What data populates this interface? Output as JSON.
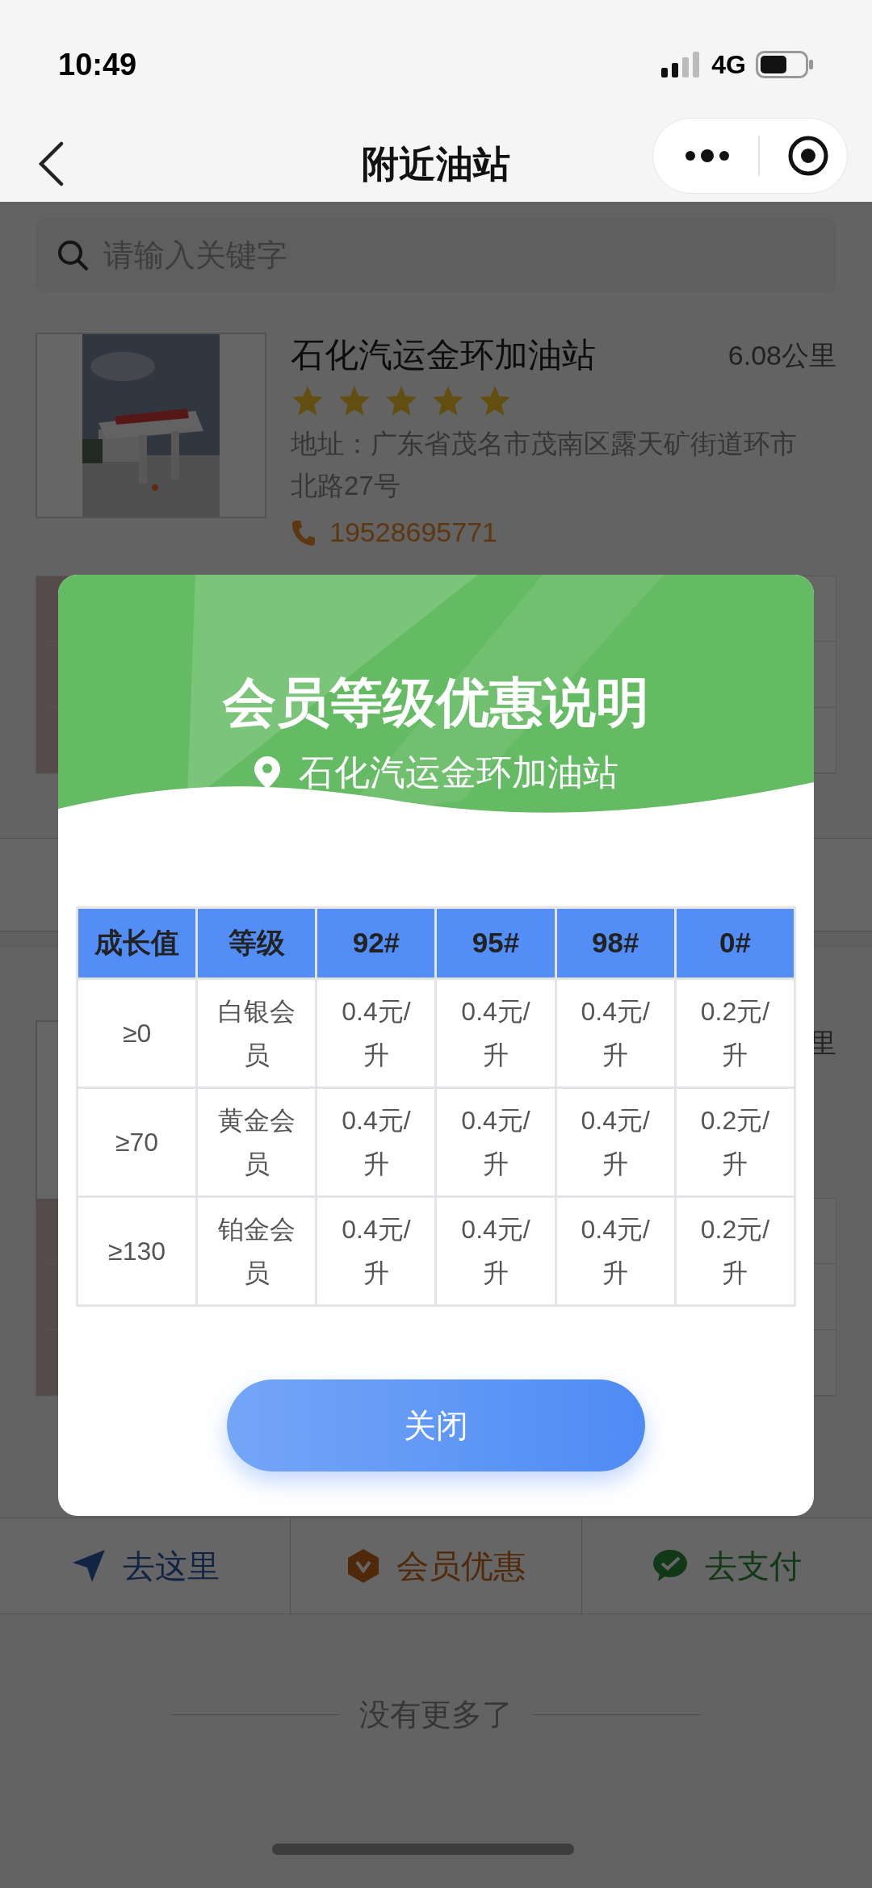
{
  "status_bar": {
    "time": "10:49",
    "network": "4G"
  },
  "nav": {
    "title": "附近油站"
  },
  "search": {
    "placeholder": "请输入关键字"
  },
  "stations": [
    {
      "name": "石化汽运金环加油站",
      "distance": "6.08公里",
      "stars": 5,
      "address": "地址：广东省茂名市茂南区露天矿街道环市北路27号",
      "phone": "19528695771"
    },
    {
      "distance": "里"
    }
  ],
  "actions": [
    {
      "kind": "navigate",
      "label": "去这里"
    },
    {
      "kind": "member",
      "label": "会员优惠"
    },
    {
      "kind": "pay",
      "label": "去支付"
    }
  ],
  "end_text": "没有更多了",
  "modal": {
    "title": "会员等级优惠说明",
    "station": "石化汽运金环加油站",
    "table": {
      "columns": [
        "成长值",
        "等级",
        "92#",
        "95#",
        "98#",
        "0#"
      ],
      "rows": [
        [
          "≥0",
          "白银会员",
          "0.4元/升",
          "0.4元/升",
          "0.4元/升",
          "0.2元/升"
        ],
        [
          "≥70",
          "黄金会员",
          "0.4元/升",
          "0.4元/升",
          "0.4元/升",
          "0.2元/升"
        ],
        [
          "≥130",
          "铂金会员",
          "0.4元/升",
          "0.4元/升",
          "0.4元/升",
          "0.2元/升"
        ]
      ]
    },
    "close_button": "关闭"
  }
}
